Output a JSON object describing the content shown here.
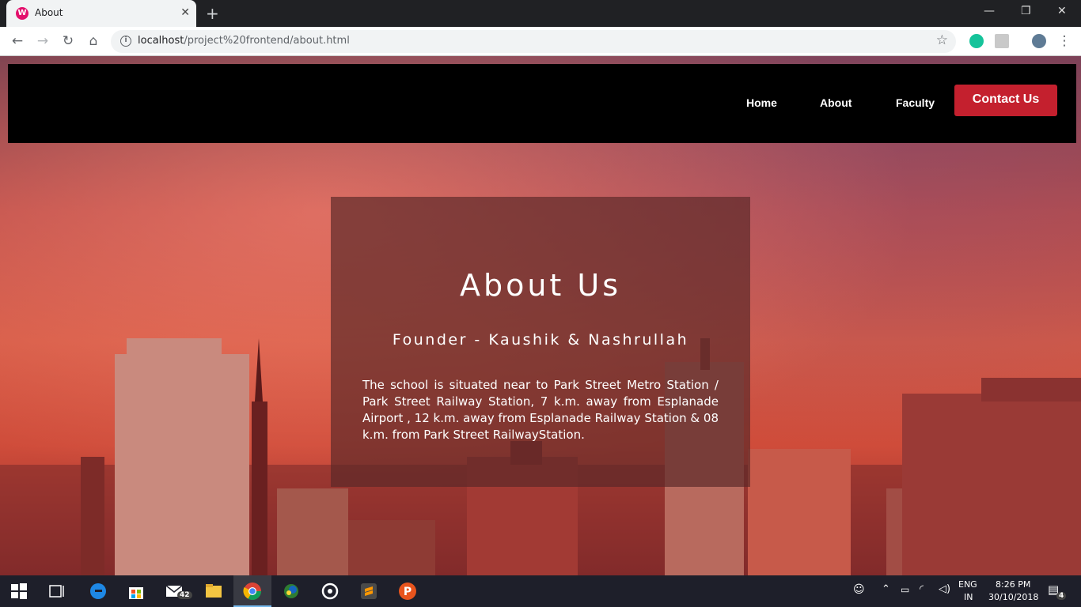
{
  "browser": {
    "tab_title": "About",
    "tab_favicon": "W",
    "new_tab": "+",
    "url_host": "localhost",
    "url_path": "/project%20frontend/about.html",
    "window_controls": {
      "minimize": "—",
      "restore": "❐",
      "close": "✕"
    },
    "nav_icons": [
      "back-arrow-icon",
      "forward-arrow-icon",
      "reload-icon",
      "home-icon"
    ]
  },
  "site": {
    "nav": {
      "links": [
        "Home",
        "About",
        "Faculty"
      ],
      "contact_label": "Contact Us"
    },
    "about": {
      "title": "About Us",
      "founder": "Founder - Kaushik & Nashrullah",
      "description": "The school is situated near to Park Street Metro Station / Park Street Railway Station, 7 k.m. away from Esplanade Airport , 12 k.m. away from Esplanade Railway Station & 08 k.m. from Park Street RailwayStation."
    },
    "colors": {
      "nav_bg": "#000000",
      "contact_bg": "#c4202e"
    }
  },
  "taskbar": {
    "mail_badge": "42",
    "lang_top": "ENG",
    "lang_bottom": "IN",
    "time": "8:26 PM",
    "date": "30/10/2018",
    "notification_count": "4"
  }
}
